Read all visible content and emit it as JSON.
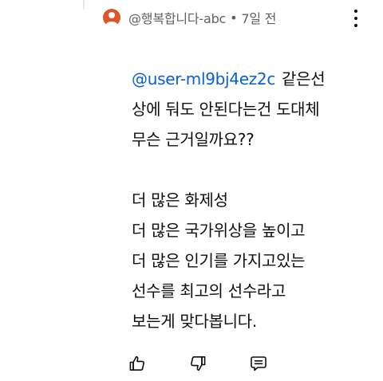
{
  "comment": {
    "author": "@행복합니다-abc",
    "separator": "•",
    "timestamp": "7일 전",
    "mention": "@user-ml9bj4ez2c",
    "lines": [
      "같은선",
      "상에 둬도 안된다는건 도대체",
      "무슨 근거일까요??",
      "",
      "더 많은 화제성",
      "더 많은 국가위상을 높이고",
      "더 많은 인기를 가지고있는",
      "선수를 최고의 선수라고",
      "보는게 맞다봅니다."
    ]
  },
  "icons": {
    "avatar": "default-avatar-icon",
    "more": "more-vert-icon",
    "like": "thumb-up-icon",
    "dislike": "thumb-down-icon",
    "reply": "reply-icon"
  },
  "colors": {
    "mention": "#065fd4",
    "avatar": "#e0542b",
    "meta": "#606060",
    "text": "#0f0f0f"
  }
}
